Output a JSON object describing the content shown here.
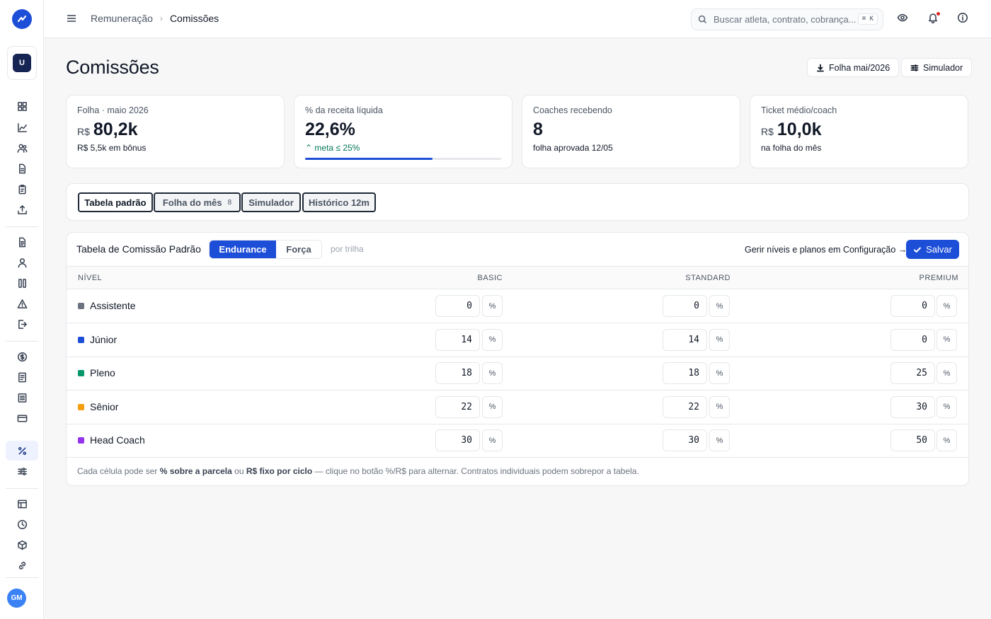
{
  "workspace_initial": "U",
  "user_initials": "GM",
  "breadcrumb": {
    "parent": "Remuneração",
    "current": "Comissões"
  },
  "search": {
    "placeholder": "Buscar atleta, contrato, cobrança...",
    "shortcut": "⌘ K"
  },
  "page_title": "Comissões",
  "header_buttons": {
    "payroll": "Folha mai/2026",
    "simulator": "Simulador"
  },
  "stats": [
    {
      "label": "Folha · maio 2026",
      "currency": "R$",
      "value": "80,2k",
      "sub": "R$ 5,5k em bônus"
    },
    {
      "label": "% da receita líquida",
      "value": "22,6%",
      "sub": "meta ≤ 25%",
      "progress": 0.65
    },
    {
      "label": "Coaches recebendo",
      "value": "8",
      "sub": "folha aprovada 12/05"
    },
    {
      "label": "Ticket médio/coach",
      "currency": "R$",
      "value": "10,0k",
      "sub": "na folha do mês"
    }
  ],
  "tabs": [
    {
      "label": "Tabela padrão",
      "active": true
    },
    {
      "label": "Folha do mês",
      "count": "8"
    },
    {
      "label": "Simulador"
    },
    {
      "label": "Histórico 12m"
    }
  ],
  "table": {
    "title": "Tabela de Comissão Padrão",
    "tracks": [
      "Endurance",
      "Força"
    ],
    "active_track": "Endurance",
    "track_hint": "por trilha",
    "config_link": "Gerir níveis e planos em Configuração →",
    "save_label": "Salvar",
    "columns": [
      "NÍVEL",
      "BASIC",
      "STANDARD",
      "PREMIUM"
    ],
    "unit": "%",
    "rows": [
      {
        "level": "Assistente",
        "color": "#6b7280",
        "basic": "0",
        "standard": "0",
        "premium": "0"
      },
      {
        "level": "Júnior",
        "color": "#1d4ed8",
        "basic": "14",
        "standard": "14",
        "premium": "0"
      },
      {
        "level": "Pleno",
        "color": "#059669",
        "basic": "18",
        "standard": "18",
        "premium": "25"
      },
      {
        "level": "Sênior",
        "color": "#f59e0b",
        "basic": "22",
        "standard": "22",
        "premium": "30"
      },
      {
        "level": "Head Coach",
        "color": "#9333ea",
        "basic": "30",
        "standard": "30",
        "premium": "50"
      }
    ],
    "footnote": {
      "p1": "Cada célula pode ser ",
      "b1": "% sobre a parcela",
      "p2": " ou ",
      "b2": "R$ fixo por ciclo",
      "p3": " — clique no botão %/R$ para alternar. Contratos individuais podem sobrepor a tabela."
    }
  }
}
